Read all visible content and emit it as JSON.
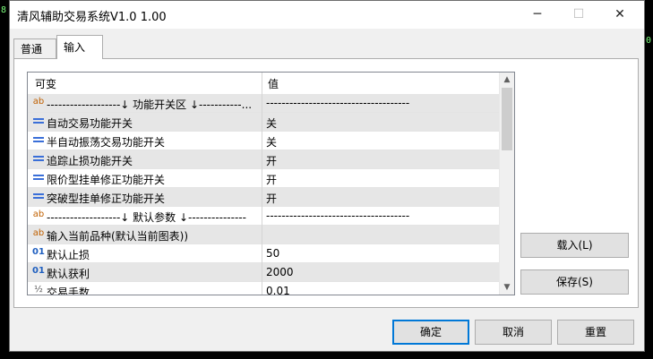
{
  "window": {
    "title": "清风辅助交易系统V1.0 1.00",
    "minimize": "─",
    "maximize": "☐",
    "close": "✕"
  },
  "background": {
    "left_mark": "8",
    "right_mark": "0"
  },
  "tabs": [
    {
      "label": "普通",
      "active": false
    },
    {
      "label": "输入",
      "active": true
    }
  ],
  "grid": {
    "col_variable": "可变",
    "col_value": "值",
    "rows": [
      {
        "icon": "ab",
        "name": "-------------------↓ 功能开关区 ↓-----------...",
        "value": "-------------------------------------"
      },
      {
        "icon": "list",
        "name": "自动交易功能开关",
        "value": "关"
      },
      {
        "icon": "list",
        "name": "半自动振荡交易功能开关",
        "value": "关"
      },
      {
        "icon": "list",
        "name": "追踪止损功能开关",
        "value": "开"
      },
      {
        "icon": "list",
        "name": "限价型挂单修正功能开关",
        "value": "开"
      },
      {
        "icon": "list",
        "name": "突破型挂单修正功能开关",
        "value": "开"
      },
      {
        "icon": "ab",
        "name": "-------------------↓ 默认参数 ↓---------------",
        "value": "-------------------------------------"
      },
      {
        "icon": "ab",
        "name": "输入当前品种(默认当前图表))",
        "value": ""
      },
      {
        "icon": "01",
        "name": "默认止损",
        "value": "50"
      },
      {
        "icon": "01",
        "name": "默认获利",
        "value": "2000"
      },
      {
        "icon": "½",
        "name": "交易手数",
        "value": "0.01"
      }
    ],
    "scroll_up": "▲",
    "scroll_down": "▼"
  },
  "side_buttons": {
    "load": "载入(L)",
    "save": "保存(S)"
  },
  "footer": {
    "ok": "确定",
    "cancel": "取消",
    "reset": "重置"
  }
}
